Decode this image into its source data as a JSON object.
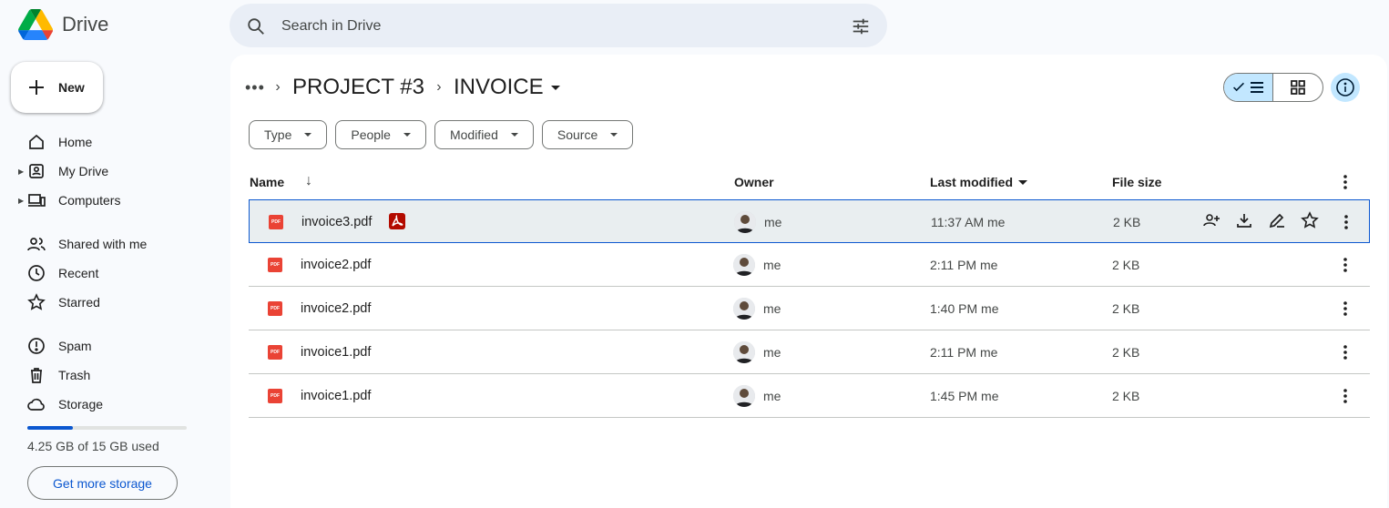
{
  "app": {
    "name": "Drive"
  },
  "search": {
    "placeholder": "Search in Drive"
  },
  "sidebar": {
    "new_label": "New",
    "items": [
      {
        "label": "Home",
        "icon": "home-icon",
        "caret": false
      },
      {
        "label": "My Drive",
        "icon": "my-drive-icon",
        "caret": true
      },
      {
        "label": "Computers",
        "icon": "computers-icon",
        "caret": true
      },
      {
        "label": "Shared with me",
        "icon": "shared-icon",
        "caret": false
      },
      {
        "label": "Recent",
        "icon": "clock-icon",
        "caret": false
      },
      {
        "label": "Starred",
        "icon": "star-icon",
        "caret": false
      },
      {
        "label": "Spam",
        "icon": "spam-icon",
        "caret": false
      },
      {
        "label": "Trash",
        "icon": "trash-icon",
        "caret": false
      },
      {
        "label": "Storage",
        "icon": "cloud-icon",
        "caret": false
      }
    ],
    "storage_text": "4.25 GB of 15 GB used",
    "storage_fraction": 0.283,
    "get_storage_label": "Get more storage"
  },
  "breadcrumb": {
    "parent": "PROJECT #3",
    "current": "INVOICE"
  },
  "filters": [
    "Type",
    "People",
    "Modified",
    "Source"
  ],
  "table": {
    "columns": {
      "name": "Name",
      "owner": "Owner",
      "last_modified": "Last modified",
      "size": "File size"
    },
    "rows": [
      {
        "name": "invoice3.pdf",
        "owner": "me",
        "modified": "11:37 AM me",
        "size": "2 KB",
        "selected": true
      },
      {
        "name": "invoice2.pdf",
        "owner": "me",
        "modified": "2:11 PM me",
        "size": "2 KB",
        "selected": false
      },
      {
        "name": "invoice2.pdf",
        "owner": "me",
        "modified": "1:40 PM me",
        "size": "2 KB",
        "selected": false
      },
      {
        "name": "invoice1.pdf",
        "owner": "me",
        "modified": "2:11 PM me",
        "size": "2 KB",
        "selected": false
      },
      {
        "name": "invoice1.pdf",
        "owner": "me",
        "modified": "1:45 PM me",
        "size": "2 KB",
        "selected": false
      }
    ]
  },
  "colors": {
    "accent": "#0b57d0",
    "selected_bg": "#c2e7ff",
    "pdf_red": "#ea4335"
  }
}
